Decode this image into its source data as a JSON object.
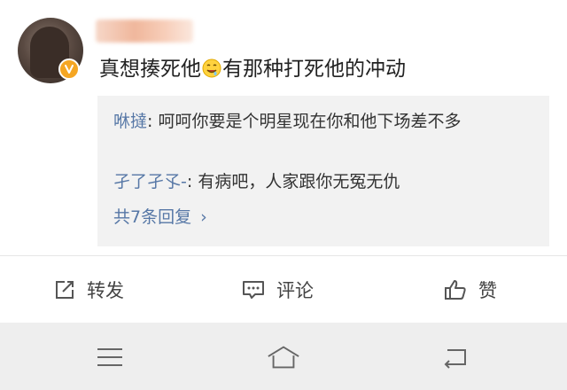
{
  "comment": {
    "username": "",
    "text_before": "真想揍死他",
    "emoji_icon": "drooling-face-emoji",
    "text_after": "有那种打死他的冲动",
    "avatar_badge": "verified-v-badge"
  },
  "replies": [
    {
      "name": "咻撻",
      "separator": ": ",
      "text": "呵呵你要是个明星现在你和他下场差不多"
    },
    {
      "name": "孑了孑孓-",
      "separator": ": ",
      "text": "有病吧，人家跟你无冤无仇"
    }
  ],
  "more_replies": {
    "label": "共7条回复",
    "chevron": "›"
  },
  "actions": {
    "repost": {
      "icon": "repost-icon",
      "label": "转发"
    },
    "comment": {
      "icon": "comment-icon",
      "label": "评论"
    },
    "like": {
      "icon": "thumbs-up-icon",
      "label": "赞"
    }
  },
  "navbar": {
    "menu": "menu-icon",
    "home": "home-icon",
    "back": "back-icon"
  },
  "colors": {
    "link": "#5677a6",
    "reply_bg": "#f2f2f2",
    "navbar_bg": "#eeeeee",
    "badge": "#f5a623"
  }
}
